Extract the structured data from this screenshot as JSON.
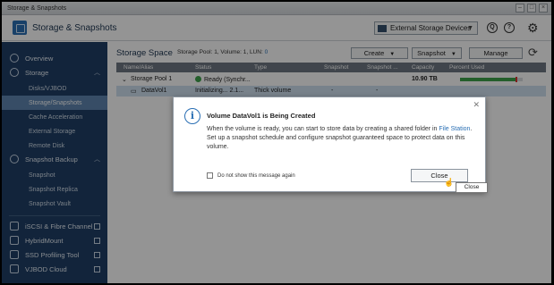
{
  "window": {
    "title": "Storage & Snapshots",
    "controls": [
      "–",
      "□",
      "×"
    ]
  },
  "header": {
    "app_title": "Storage & Snapshots",
    "external_storage_label": "External Storage Devices",
    "help_glyph": "?",
    "search_glyph": "Q"
  },
  "sidebar": {
    "overview": "Overview",
    "storage": "Storage",
    "storage_sub": [
      "Disks/VJBOD",
      "Storage/Snapshots",
      "Cache Acceleration",
      "External Storage",
      "Remote Disk"
    ],
    "snapshot_backup": "Snapshot Backup",
    "snapshot_sub": [
      "Snapshot",
      "Snapshot Replica",
      "Snapshot Vault"
    ],
    "links": [
      "iSCSI & Fibre Channel",
      "HybridMount",
      "SSD Profiling Tool",
      "VJBOD Cloud"
    ]
  },
  "main": {
    "title": "Storage Space",
    "meta_prefix": "Storage Pool: 1, Volume: 1, LUN:",
    "meta_lun": "0",
    "buttons": {
      "create": "Create",
      "snapshot": "Snapshot",
      "manage": "Manage"
    },
    "columns": [
      "Name/Alias",
      "Status",
      "Type",
      "Snapshot",
      "Snapshot ...",
      "Capacity",
      "Percent Used"
    ],
    "rows": [
      {
        "name": "Storage Pool 1",
        "status": "Ready (Synchr...",
        "type": "",
        "capacity": "10.90 TB"
      },
      {
        "name": "DataVol1",
        "status": "Initializing... 2.1...",
        "type": "Thick volume",
        "snapshot": "-",
        "snapshot2": "-"
      }
    ],
    "pool_usage_percent": 88
  },
  "dialog": {
    "title": "Volume DataVol1 is Being Created",
    "body_part1": "When the volume is ready, you can start to store data by creating a shared folder in",
    "body_link": "File Station",
    "body_part2": "Set up a snapshot schedule and configure snapshot guaranteed space to protect data on this volume.",
    "checkbox_label": "Do not show this message again",
    "close_button": "Close",
    "tooltip": "Close"
  },
  "colors": {
    "sidebar_bg": "#1f3f66",
    "sidebar_active": "#5f86b0",
    "accent": "#2a6fb4",
    "ok_green": "#3ea34a"
  }
}
